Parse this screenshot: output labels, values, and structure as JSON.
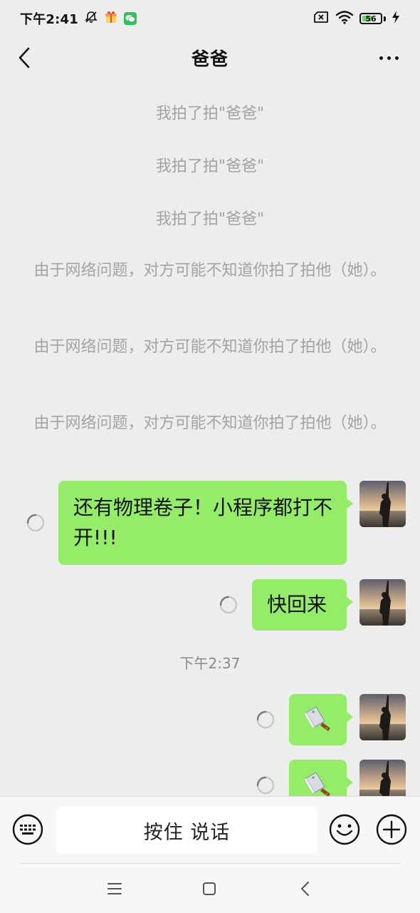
{
  "status_bar": {
    "time": "下午2:41",
    "battery_level": "56",
    "battery_fraction": 0.56,
    "icons": [
      "bell-off-icon",
      "gift-app-icon",
      "wechat-icon",
      "sim-off-icon",
      "wifi-icon",
      "battery-icon",
      "charging-icon"
    ]
  },
  "header": {
    "title": "爸爸",
    "back_icon": "back-arrow-icon",
    "more_icon": "more-icon"
  },
  "messages": {
    "system": [
      "我拍了拍\"爸爸\"",
      "我拍了拍\"爸爸\"",
      "我拍了拍\"爸爸\"",
      "由于网络问题，对方可能不知道你拍了拍他（她）。",
      "由于网络问题，对方可能不知道你拍了拍他（她）。",
      "由于网络问题，对方可能不知道你拍了拍他（她）。"
    ],
    "text": [
      "还有物理卷子！小程序都打不开!!!",
      "快回来"
    ],
    "timestamp": "下午2:37",
    "emoji": [
      "kitchen-knife",
      "kitchen-knife"
    ],
    "status": "sending"
  },
  "input": {
    "voice_label": "按住 说话",
    "left_icon": "keyboard-icon",
    "emoji_icon": "emoji-icon",
    "plus_icon": "plus-icon"
  },
  "navbar": {
    "icons": [
      "menu-icon",
      "home-icon",
      "back-icon"
    ]
  }
}
